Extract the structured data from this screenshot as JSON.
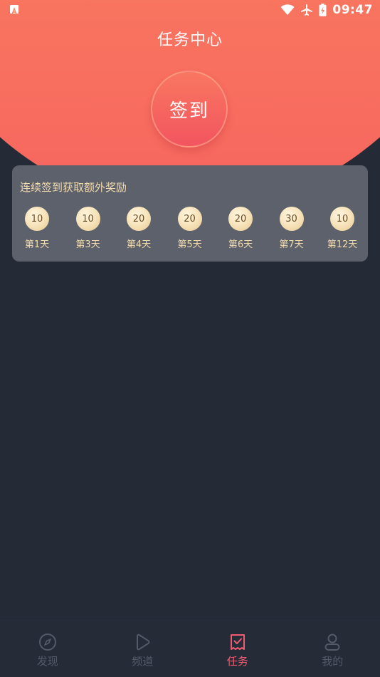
{
  "status_bar": {
    "time": "09:47",
    "icons": [
      "app-notification-icon",
      "wifi-icon",
      "airplane-icon",
      "battery-icon"
    ]
  },
  "header": {
    "title": "任务中心"
  },
  "checkin": {
    "label": "签到"
  },
  "reward_card": {
    "title": "连续签到获取额外奖励",
    "days": [
      {
        "points": "10",
        "label": "第1天"
      },
      {
        "points": "10",
        "label": "第3天"
      },
      {
        "points": "20",
        "label": "第4天"
      },
      {
        "points": "20",
        "label": "第5天"
      },
      {
        "points": "20",
        "label": "第6天"
      },
      {
        "points": "30",
        "label": "第7天"
      },
      {
        "points": "10",
        "label": "第12天"
      }
    ]
  },
  "bottom_nav": {
    "items": [
      {
        "label": "发现",
        "icon": "compass-icon",
        "active": false
      },
      {
        "label": "频道",
        "icon": "play-icon",
        "active": false
      },
      {
        "label": "任务",
        "icon": "task-icon",
        "active": true
      },
      {
        "label": "我的",
        "icon": "user-icon",
        "active": false
      }
    ]
  },
  "colors": {
    "background": "#252a37",
    "header_gradient_top": "#fb8b61",
    "header_gradient_bottom": "#f6655f",
    "card_background": "#5d616c",
    "gold_text": "#f1d9ad",
    "nav_active": "#f15c72",
    "nav_inactive": "#545a68"
  }
}
